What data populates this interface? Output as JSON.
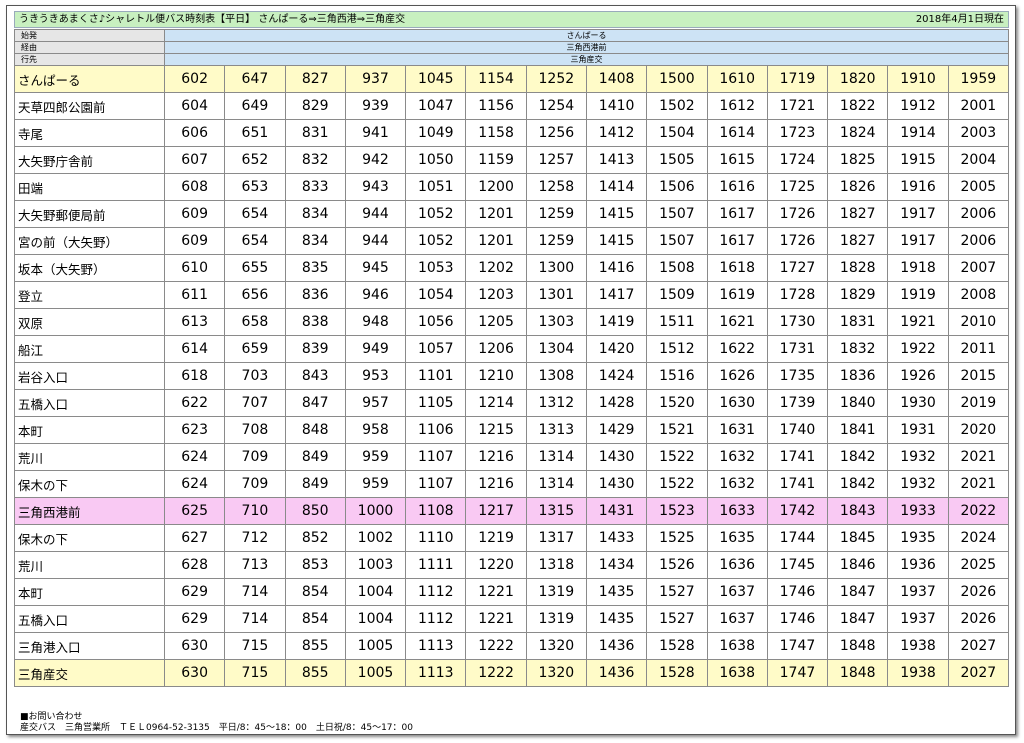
{
  "header": {
    "title": "うきうきあまくさ♪シャレトル便バス時刻表【平日】 さんぱーる⇒三角西港⇒三角産交",
    "date": "2018年4月1日現在"
  },
  "meta": [
    {
      "label": "始発",
      "value": "さんぱーる"
    },
    {
      "label": "経由",
      "value": "三角西港前"
    },
    {
      "label": "行先",
      "value": "三角産交"
    }
  ],
  "stops": [
    {
      "name": "さんぱーる",
      "highlight": "yellow",
      "times": [
        "602",
        "647",
        "827",
        "937",
        "1045",
        "1154",
        "1252",
        "1408",
        "1500",
        "1610",
        "1719",
        "1820",
        "1910",
        "1959"
      ]
    },
    {
      "name": "天草四郎公園前",
      "highlight": "",
      "times": [
        "604",
        "649",
        "829",
        "939",
        "1047",
        "1156",
        "1254",
        "1410",
        "1502",
        "1612",
        "1721",
        "1822",
        "1912",
        "2001"
      ]
    },
    {
      "name": "寺尾",
      "highlight": "",
      "times": [
        "606",
        "651",
        "831",
        "941",
        "1049",
        "1158",
        "1256",
        "1412",
        "1504",
        "1614",
        "1723",
        "1824",
        "1914",
        "2003"
      ]
    },
    {
      "name": "大矢野庁舎前",
      "highlight": "",
      "times": [
        "607",
        "652",
        "832",
        "942",
        "1050",
        "1159",
        "1257",
        "1413",
        "1505",
        "1615",
        "1724",
        "1825",
        "1915",
        "2004"
      ]
    },
    {
      "name": "田端",
      "highlight": "",
      "times": [
        "608",
        "653",
        "833",
        "943",
        "1051",
        "1200",
        "1258",
        "1414",
        "1506",
        "1616",
        "1725",
        "1826",
        "1916",
        "2005"
      ]
    },
    {
      "name": "大矢野郵便局前",
      "highlight": "",
      "times": [
        "609",
        "654",
        "834",
        "944",
        "1052",
        "1201",
        "1259",
        "1415",
        "1507",
        "1617",
        "1726",
        "1827",
        "1917",
        "2006"
      ]
    },
    {
      "name": "宮の前（大矢野）",
      "highlight": "",
      "times": [
        "609",
        "654",
        "834",
        "944",
        "1052",
        "1201",
        "1259",
        "1415",
        "1507",
        "1617",
        "1726",
        "1827",
        "1917",
        "2006"
      ]
    },
    {
      "name": "坂本（大矢野）",
      "highlight": "",
      "times": [
        "610",
        "655",
        "835",
        "945",
        "1053",
        "1202",
        "1300",
        "1416",
        "1508",
        "1618",
        "1727",
        "1828",
        "1918",
        "2007"
      ]
    },
    {
      "name": "登立",
      "highlight": "",
      "times": [
        "611",
        "656",
        "836",
        "946",
        "1054",
        "1203",
        "1301",
        "1417",
        "1509",
        "1619",
        "1728",
        "1829",
        "1919",
        "2008"
      ]
    },
    {
      "name": "双原",
      "highlight": "",
      "times": [
        "613",
        "658",
        "838",
        "948",
        "1056",
        "1205",
        "1303",
        "1419",
        "1511",
        "1621",
        "1730",
        "1831",
        "1921",
        "2010"
      ]
    },
    {
      "name": "船江",
      "highlight": "",
      "times": [
        "614",
        "659",
        "839",
        "949",
        "1057",
        "1206",
        "1304",
        "1420",
        "1512",
        "1622",
        "1731",
        "1832",
        "1922",
        "2011"
      ]
    },
    {
      "name": "岩谷入口",
      "highlight": "",
      "times": [
        "618",
        "703",
        "843",
        "953",
        "1101",
        "1210",
        "1308",
        "1424",
        "1516",
        "1626",
        "1735",
        "1836",
        "1926",
        "2015"
      ]
    },
    {
      "name": "五橋入口",
      "highlight": "",
      "times": [
        "622",
        "707",
        "847",
        "957",
        "1105",
        "1214",
        "1312",
        "1428",
        "1520",
        "1630",
        "1739",
        "1840",
        "1930",
        "2019"
      ]
    },
    {
      "name": "本町",
      "highlight": "",
      "times": [
        "623",
        "708",
        "848",
        "958",
        "1106",
        "1215",
        "1313",
        "1429",
        "1521",
        "1631",
        "1740",
        "1841",
        "1931",
        "2020"
      ]
    },
    {
      "name": "荒川",
      "highlight": "",
      "times": [
        "624",
        "709",
        "849",
        "959",
        "1107",
        "1216",
        "1314",
        "1430",
        "1522",
        "1632",
        "1741",
        "1842",
        "1932",
        "2021"
      ]
    },
    {
      "name": "保木の下",
      "highlight": "",
      "times": [
        "624",
        "709",
        "849",
        "959",
        "1107",
        "1216",
        "1314",
        "1430",
        "1522",
        "1632",
        "1741",
        "1842",
        "1932",
        "2021"
      ]
    },
    {
      "name": "三角西港前",
      "highlight": "pink",
      "times": [
        "625",
        "710",
        "850",
        "1000",
        "1108",
        "1217",
        "1315",
        "1431",
        "1523",
        "1633",
        "1742",
        "1843",
        "1933",
        "2022"
      ]
    },
    {
      "name": "保木の下",
      "highlight": "",
      "times": [
        "627",
        "712",
        "852",
        "1002",
        "1110",
        "1219",
        "1317",
        "1433",
        "1525",
        "1635",
        "1744",
        "1845",
        "1935",
        "2024"
      ]
    },
    {
      "name": "荒川",
      "highlight": "",
      "times": [
        "628",
        "713",
        "853",
        "1003",
        "1111",
        "1220",
        "1318",
        "1434",
        "1526",
        "1636",
        "1745",
        "1846",
        "1936",
        "2025"
      ]
    },
    {
      "name": "本町",
      "highlight": "",
      "times": [
        "629",
        "714",
        "854",
        "1004",
        "1112",
        "1221",
        "1319",
        "1435",
        "1527",
        "1637",
        "1746",
        "1847",
        "1937",
        "2026"
      ]
    },
    {
      "name": "五橋入口",
      "highlight": "",
      "times": [
        "629",
        "714",
        "854",
        "1004",
        "1112",
        "1221",
        "1319",
        "1435",
        "1527",
        "1637",
        "1746",
        "1847",
        "1937",
        "2026"
      ]
    },
    {
      "name": "三角港入口",
      "highlight": "",
      "times": [
        "630",
        "715",
        "855",
        "1005",
        "1113",
        "1222",
        "1320",
        "1436",
        "1528",
        "1638",
        "1747",
        "1848",
        "1938",
        "2027"
      ]
    },
    {
      "name": "三角産交",
      "highlight": "yellow",
      "times": [
        "630",
        "715",
        "855",
        "1005",
        "1113",
        "1222",
        "1320",
        "1436",
        "1528",
        "1638",
        "1747",
        "1848",
        "1938",
        "2027"
      ]
    }
  ],
  "footer": {
    "line1": "■お問い合わせ",
    "line2": "産交バス　三角営業所　ＴＥＬ0964-52-3135　平日/8：45～18：00　土日祝/8：45～17：00"
  },
  "colors": {
    "title_bg": "#c8f0c0",
    "meta_value_bg": "#cde3f5",
    "highlight_yellow": "#fffbc8",
    "highlight_pink": "#f9c9f3"
  }
}
